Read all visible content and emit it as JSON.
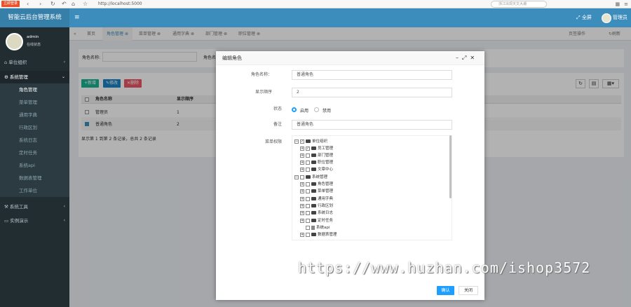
{
  "browser": {
    "badge": "立即登录",
    "url": "http://localhost:5000",
    "search_placeholder": "浙江出现天文大潮"
  },
  "app": {
    "title": "智能云后台管理系统",
    "fullscreen": "全屏",
    "user": "管理员"
  },
  "sidebar": {
    "user_name": "admin",
    "status": "在线状态",
    "items": [
      {
        "label": "单位组织"
      },
      {
        "label": "系统管理"
      },
      {
        "label": "系统工具"
      },
      {
        "label": "实例演示"
      }
    ],
    "sub": [
      {
        "label": "角色管理"
      },
      {
        "label": "菜单管理"
      },
      {
        "label": "通用字典"
      },
      {
        "label": "行政区划"
      },
      {
        "label": "系统日志"
      },
      {
        "label": "定时任务"
      },
      {
        "label": "系统api"
      },
      {
        "label": "数据表管理"
      },
      {
        "label": "工作单位"
      }
    ]
  },
  "tabs": [
    {
      "label": "首页"
    },
    {
      "label": "角色管理"
    },
    {
      "label": "菜单管理"
    },
    {
      "label": "通用字典"
    },
    {
      "label": "部门管理"
    },
    {
      "label": "职位管理"
    }
  ],
  "tab_actions": {
    "page_ops": "页签操作",
    "refresh": "刷新"
  },
  "search": {
    "role_name_label": "角色名称:",
    "role_short": "角色名"
  },
  "toolbar": {
    "add": "新增",
    "edit": "修改",
    "delete": "删除"
  },
  "grid": {
    "headers": [
      "角色名称",
      "显示顺序"
    ],
    "rows": [
      {
        "name": "管理员",
        "order": "1"
      },
      {
        "name": "普通角色",
        "order": "2"
      }
    ],
    "footer": "显示第 1 到第 2 条记录，总共 2 条记录"
  },
  "modal": {
    "title": "编辑角色",
    "labels": {
      "name": "角色名称：",
      "order": "显示顺序",
      "status": "状态",
      "remark": "备注",
      "perm": "菜单权限"
    },
    "values": {
      "name": "普通角色",
      "order": "2",
      "remark": "普通角色"
    },
    "status_options": {
      "enable": "启用",
      "disable": "禁用"
    },
    "tree": [
      {
        "label": "单位组织"
      },
      {
        "label": "员工管理"
      },
      {
        "label": "部门管理"
      },
      {
        "label": "职位管理"
      },
      {
        "label": "文章中心"
      },
      {
        "label": "系统管理"
      },
      {
        "label": "角色管理"
      },
      {
        "label": "菜单管理"
      },
      {
        "label": "通用字典"
      },
      {
        "label": "行政区划"
      },
      {
        "label": "系统日志"
      },
      {
        "label": "定时任务"
      },
      {
        "label": "系统api"
      },
      {
        "label": "数据表管理"
      }
    ],
    "ok": "确认",
    "cancel": "关闭"
  },
  "watermark": "https://www.huzhan.com/ishop3572"
}
